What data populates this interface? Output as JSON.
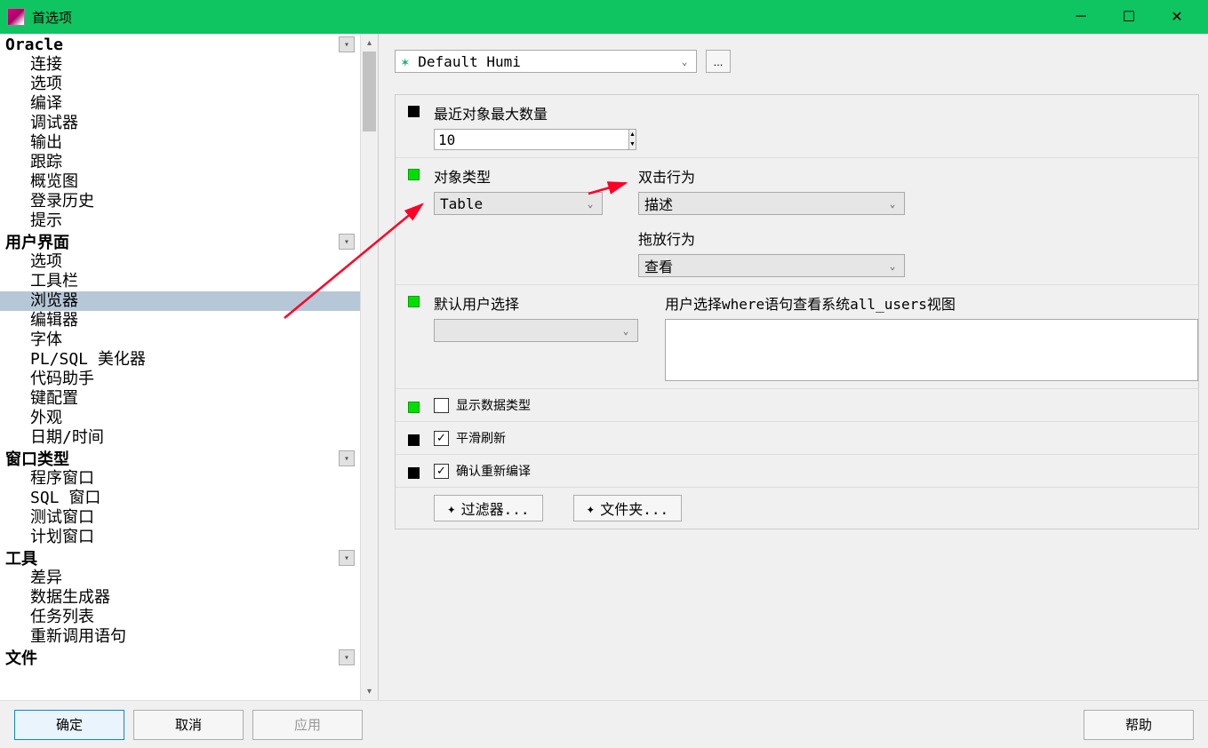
{
  "title": "首选项",
  "sidebar": {
    "groups": [
      {
        "label": "Oracle",
        "items": [
          "连接",
          "选项",
          "编译",
          "调试器",
          "输出",
          "跟踪",
          "概览图",
          "登录历史",
          "提示"
        ]
      },
      {
        "label": "用户界面",
        "items": [
          "选项",
          "工具栏",
          "浏览器",
          "编辑器",
          "字体",
          "PL/SQL 美化器",
          "代码助手",
          "键配置",
          "外观",
          "日期/时间"
        ],
        "selected": 2
      },
      {
        "label": "窗口类型",
        "items": [
          "程序窗口",
          "SQL 窗口",
          "测试窗口",
          "计划窗口"
        ]
      },
      {
        "label": "工具",
        "items": [
          "差异",
          "数据生成器",
          "任务列表",
          "重新调用语句"
        ]
      },
      {
        "label": "文件",
        "items": []
      }
    ]
  },
  "profile": {
    "selected": "Default Humi",
    "more": "..."
  },
  "settings": {
    "recent_label": "最近对象最大数量",
    "recent_value": "10",
    "objtype_label": "对象类型",
    "objtype_value": "Table",
    "dblclick_label": "双击行为",
    "dblclick_value": "描述",
    "dragdrop_label": "拖放行为",
    "dragdrop_value": "查看",
    "defuser_label": "默认用户选择",
    "where_label": "用户选择where语句查看系统all_users视图",
    "show_types_label": "显示数据类型",
    "show_types_checked": false,
    "smooth_label": "平滑刷新",
    "smooth_checked": true,
    "confirm_label": "确认重新编译",
    "confirm_checked": true,
    "filter_btn": "过滤器...",
    "folder_btn": "文件夹..."
  },
  "buttons": {
    "ok": "确定",
    "cancel": "取消",
    "apply": "应用",
    "help": "帮助"
  }
}
